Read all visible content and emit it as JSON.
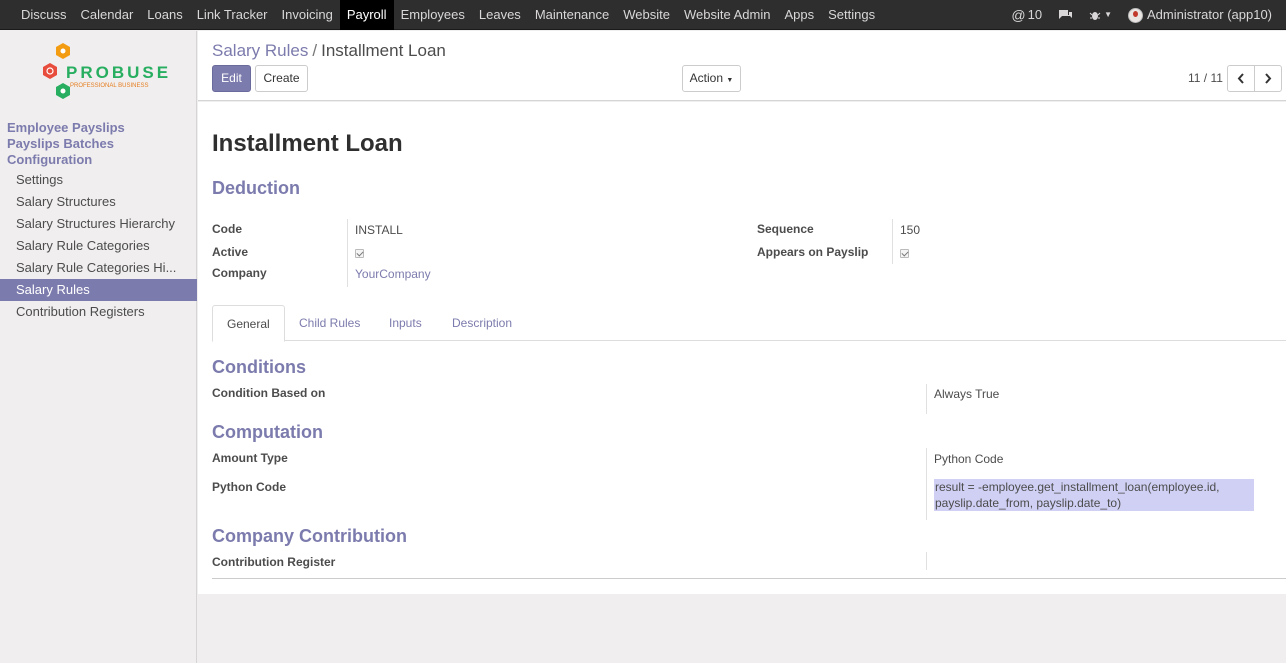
{
  "topbar": {
    "menu": [
      "Discuss",
      "Calendar",
      "Loans",
      "Link Tracker",
      "Invoicing",
      "Payroll",
      "Employees",
      "Leaves",
      "Maintenance",
      "Website",
      "Website Admin",
      "Apps",
      "Settings"
    ],
    "active_menu": "Payroll",
    "mentions_count": "10",
    "user": "Administrator (app10)"
  },
  "sidebar": {
    "logo_text": "PROBUSE",
    "logo_subtext": "PROFESSIONAL BUSINESS",
    "sections": [
      "Employee Payslips",
      "Payslips Batches",
      "Configuration"
    ],
    "items": [
      "Settings",
      "Salary Structures",
      "Salary Structures Hierarchy",
      "Salary Rule Categories",
      "Salary Rule Categories Hi...",
      "Salary Rules",
      "Contribution Registers"
    ],
    "active_item": "Salary Rules"
  },
  "control_panel": {
    "breadcrumb_parent": "Salary Rules",
    "breadcrumb_sep": "/",
    "breadcrumb_current": "Installment Loan",
    "edit_label": "Edit",
    "create_label": "Create",
    "action_label": "Action",
    "pager": "11 / 11"
  },
  "form": {
    "title": "Installment Loan",
    "category": "Deduction",
    "fields": {
      "code_label": "Code",
      "code_value": "INSTALL",
      "active_label": "Active",
      "active_checked": true,
      "company_label": "Company",
      "company_value": "YourCompany",
      "sequence_label": "Sequence",
      "sequence_value": "150",
      "appears_label": "Appears on Payslip",
      "appears_checked": true
    },
    "tabs": [
      "General",
      "Child Rules",
      "Inputs",
      "Description"
    ],
    "active_tab": "General",
    "conditions": {
      "heading": "Conditions",
      "based_on_label": "Condition Based on",
      "based_on_value": "Always True"
    },
    "computation": {
      "heading": "Computation",
      "amount_type_label": "Amount Type",
      "amount_type_value": "Python Code",
      "python_code_label": "Python Code",
      "python_code_line1": "result = -employee.get_installment_loan(employee.id,",
      "python_code_line2": "payslip.date_from, payslip.date_to)"
    },
    "contribution": {
      "heading": "Company Contribution",
      "register_label": "Contribution Register",
      "register_value": ""
    }
  },
  "colors": {
    "accent": "#7c7bad",
    "topbar": "#2e2e2e",
    "code_highlight": "#d0d0f5"
  }
}
